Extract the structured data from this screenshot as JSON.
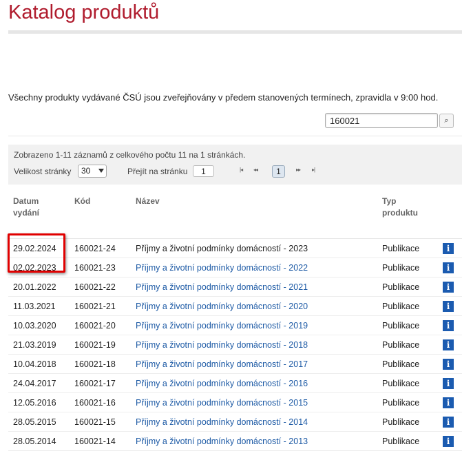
{
  "page": {
    "title": "Katalog produktů",
    "intro": "Všechny produkty vydávané ČSÚ jsou zveřejňovány v předem stanovených termínech, zpravidla v 9:00 hod."
  },
  "search": {
    "value": "160021",
    "button_icon": "search-icon",
    "button_glyph": "⌕"
  },
  "pager": {
    "info": "Zobrazeno 1-11 záznamů z celkového počtu 11 na 1 stránkách.",
    "page_size_label": "Velikost stránky",
    "page_size_value": "30",
    "goto_label": "Přejít na stránku",
    "goto_value": "1",
    "first_glyph": "|◂",
    "prev_glyph": "◂◂",
    "current_page": "1",
    "next_glyph": "▸▸",
    "last_glyph": "▸|"
  },
  "table": {
    "headers": {
      "date_line1": "Datum",
      "date_line2": "vydání",
      "code": "Kód",
      "name": "Název",
      "type_line1": "Typ",
      "type_line2": "produktu"
    },
    "info_icon_glyph": "i",
    "rows": [
      {
        "date": "29.02.2024",
        "code": "160021-24",
        "name": "Příjmy a životní podmínky domácností - 2023",
        "type": "Publikace"
      },
      {
        "date": "02.02.2023",
        "code": "160021-23",
        "name": "Příjmy a životní podmínky domácností - 2022",
        "type": "Publikace"
      },
      {
        "date": "20.01.2022",
        "code": "160021-22",
        "name": "Příjmy a životní podmínky domácností - 2021",
        "type": "Publikace"
      },
      {
        "date": "11.03.2021",
        "code": "160021-21",
        "name": "Příjmy a životní podmínky domácností - 2020",
        "type": "Publikace"
      },
      {
        "date": "10.03.2020",
        "code": "160021-20",
        "name": "Příjmy a životní podmínky domácností - 2019",
        "type": "Publikace"
      },
      {
        "date": "21.03.2019",
        "code": "160021-19",
        "name": "Příjmy a životní podmínky domácností - 2018",
        "type": "Publikace"
      },
      {
        "date": "10.04.2018",
        "code": "160021-18",
        "name": "Příjmy a životní podmínky domácností - 2017",
        "type": "Publikace"
      },
      {
        "date": "24.04.2017",
        "code": "160021-17",
        "name": "Příjmy a životní podmínky domácností - 2016",
        "type": "Publikace"
      },
      {
        "date": "12.05.2016",
        "code": "160021-16",
        "name": "Příjmy a životní podmínky domácností - 2015",
        "type": "Publikace"
      },
      {
        "date": "28.05.2015",
        "code": "160021-15",
        "name": "Příjmy a životní podmínky domácností - 2014",
        "type": "Publikace"
      },
      {
        "date": "28.05.2014",
        "code": "160021-14",
        "name": "Příjmy a životní podmínky domácností - 2013",
        "type": "Publikace"
      }
    ]
  },
  "colors": {
    "title": "#b01c2e",
    "link": "#1d5aa5",
    "info_icon": "#1b5bb0",
    "highlight": "#e10000"
  }
}
